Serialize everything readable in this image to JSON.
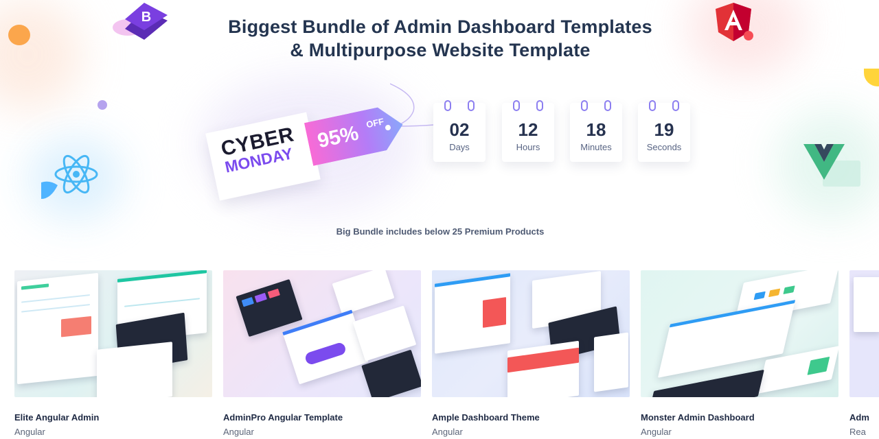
{
  "hero": {
    "title_line1": "Biggest Bundle of Admin Dashboard Templates",
    "title_line2": "& Multipurpose Website Template"
  },
  "promo": {
    "cyber": "CYBER",
    "monday": "MONDAY",
    "discount": "95%",
    "off": "OFF"
  },
  "countdown": [
    {
      "value": "02",
      "label": "Days"
    },
    {
      "value": "12",
      "label": "Hours"
    },
    {
      "value": "18",
      "label": "Minutes"
    },
    {
      "value": "19",
      "label": "Seconds"
    }
  ],
  "bundle": {
    "subtitle": "Big Bundle includes below 25 Premium Products"
  },
  "products": [
    {
      "name": "Elite Angular Admin",
      "category": "Angular"
    },
    {
      "name": "AdminPro Angular Template",
      "category": "Angular"
    },
    {
      "name": "Ample Dashboard Theme",
      "category": "Angular"
    },
    {
      "name": "Monster Admin Dashboard",
      "category": "Angular"
    },
    {
      "name": "Adm",
      "category": "Rea"
    }
  ],
  "colors": {
    "title": "#243550",
    "accent_purple": "#7b4bee",
    "tag_gradient_start": "#f86bd6",
    "tag_gradient_end": "#8aa7fb"
  },
  "icons": [
    "bootstrap-logo-icon",
    "angular-logo-icon",
    "react-logo-icon",
    "vue-logo-icon"
  ]
}
